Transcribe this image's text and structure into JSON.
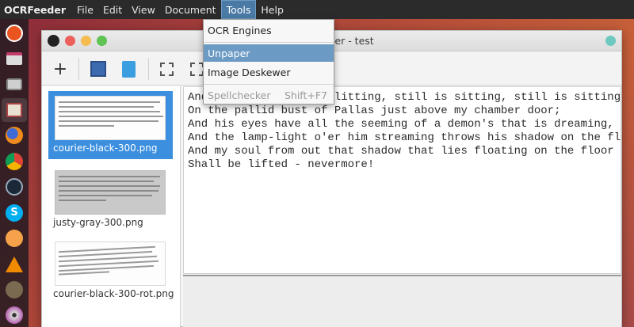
{
  "menubar": {
    "app_name": "OCRFeeder",
    "menus": [
      "File",
      "Edit",
      "View",
      "Document",
      "Tools",
      "Help"
    ],
    "active_menu": "Tools"
  },
  "launcher": {
    "items": [
      "ubuntu-icon",
      "window-icon",
      "camera-icon",
      "files-icon",
      "firefox-icon",
      "chrome-icon",
      "steam-icon",
      "skype-icon",
      "shell-icon",
      "vlc-icon",
      "gimp-icon",
      "disc-icon"
    ]
  },
  "window": {
    "title": "OCRFeeder - test",
    "titlebar_buttons": [
      "close",
      "minimize",
      "maximize"
    ]
  },
  "toolbar": {
    "items": [
      "add-icon",
      "layout-icon",
      "document-icon",
      "select-icon",
      "expand-icon"
    ]
  },
  "tools_menu": {
    "items": [
      {
        "label": "OCR Engines",
        "enabled": true
      },
      {
        "label": "Unpaper",
        "enabled": true
      },
      {
        "label": "Image Deskewer",
        "enabled": true
      },
      {
        "label": "Spellchecker",
        "shortcut": "Shift+F7",
        "enabled": false
      }
    ],
    "hovered": "Unpaper"
  },
  "pages": [
    {
      "label": "courier-black-300.png",
      "selected": true
    },
    {
      "label": "justy-gray-300.png",
      "selected": false
    },
    {
      "label": "courier-black-300-rot.png",
      "selected": false
    }
  ],
  "editor": {
    "lines": [
      "And the Raven, never flitting, still is sitting, still is sitting",
      "On the pallid bust of Pallas just above my chamber door;",
      "And his eyes have all the seeming of a demon's that is dreaming,",
      "And the lamp-light o'er him streaming throws his shadow on the floor;",
      "And my soul from out that shadow that lies floating on the floor",
      "Shall be lifted - nevermore!"
    ]
  },
  "colors": {
    "menubar": "#2b2b2b",
    "selection": "#3b8fde",
    "menu_hover": "#6b9ac4"
  }
}
